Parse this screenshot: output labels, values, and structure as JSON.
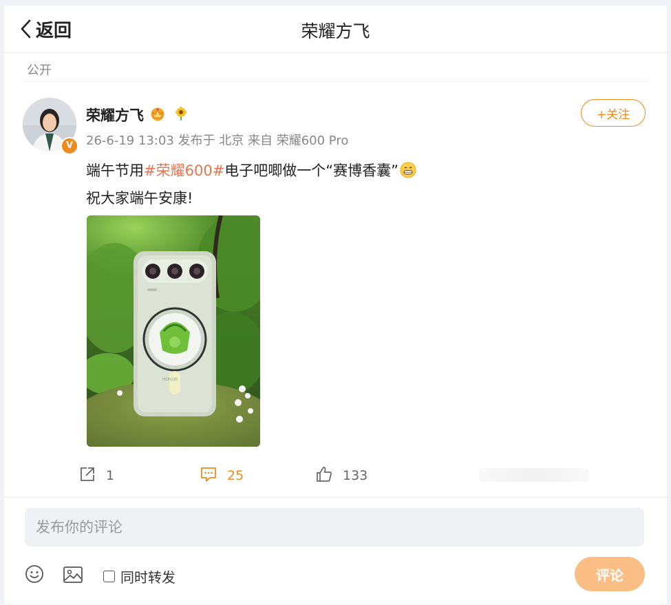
{
  "header": {
    "back_label": "返回",
    "title": "荣耀方飞"
  },
  "post": {
    "visibility": "公开",
    "author": {
      "name": "荣耀方飞",
      "verified_badge": "V",
      "badges": [
        "crown-icon",
        "sunflower-icon"
      ]
    },
    "meta": "26-6-19 13:03 发布于 北京 来自 荣耀600 Pro",
    "follow_label": "+关注",
    "text": {
      "line1_prefix": "端午节用",
      "hashtag": "#荣耀600#",
      "line1_suffix": "电子吧唧做一个“赛博香囊”",
      "line2": "祝大家端午安康!"
    },
    "image_description_icon": "phone-with-sachet-badge"
  },
  "actions": {
    "repost_count": "1",
    "comment_count": "25",
    "like_count": "133"
  },
  "comment_box": {
    "placeholder": "发布你的评论",
    "repost_label": "同时转发",
    "submit_label": "评论"
  },
  "colors": {
    "accent": "#f08a1c",
    "hashtag": "#eb7350",
    "submit_disabled": "#fbbf85"
  }
}
